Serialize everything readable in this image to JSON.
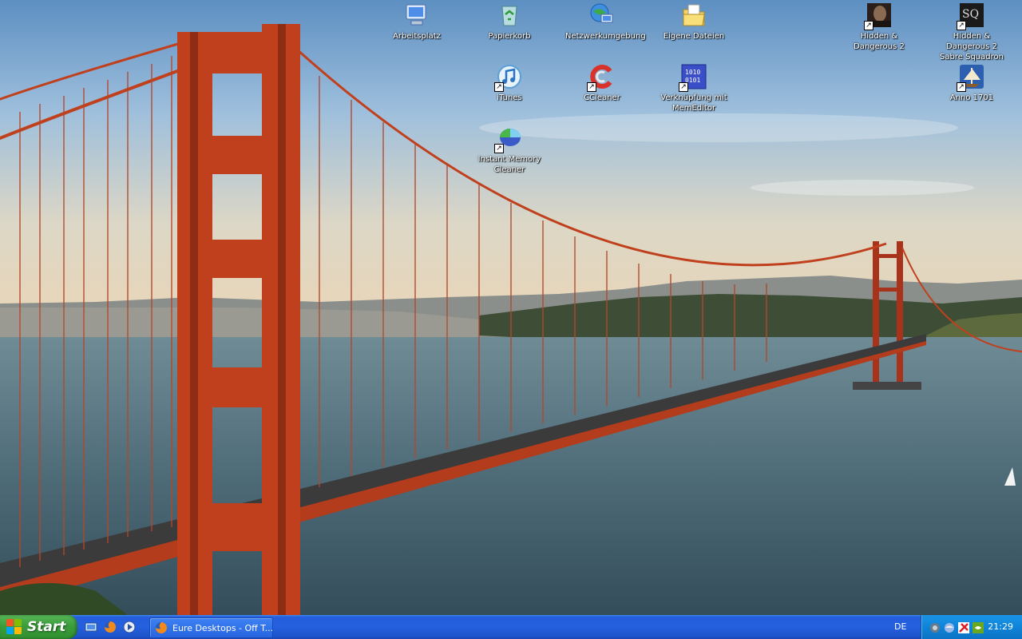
{
  "desktop": {
    "icons": [
      {
        "label": "Arbeitsplatz",
        "icon": "my-computer-icon"
      },
      {
        "label": "Papierkorb",
        "icon": "recycle-bin-icon"
      },
      {
        "label": "Netzwerkumgebung",
        "icon": "network-places-icon"
      },
      {
        "label": "Eigene Dateien",
        "icon": "my-documents-icon"
      },
      {
        "label": "Hidden & Dangerous 2",
        "icon": "hidden-dangerous-icon"
      },
      {
        "label": "Hidden & Dangerous 2 Sabre Squadron",
        "icon": "sabre-squadron-icon"
      },
      {
        "label": "iTunes",
        "icon": "itunes-icon"
      },
      {
        "label": "CCleaner",
        "icon": "ccleaner-icon"
      },
      {
        "label": "Verknüpfung mit MemEditor",
        "icon": "memeditor-icon",
        "glyph": "1010\n0101"
      },
      {
        "label": "Anno 1701",
        "icon": "anno-icon"
      },
      {
        "label": "Instant Memory Cleaner",
        "icon": "memory-cleaner-icon"
      }
    ]
  },
  "taskbar": {
    "start_label": "Start",
    "quick_launch": [
      {
        "icon": "show-desktop-icon"
      },
      {
        "icon": "firefox-icon"
      },
      {
        "icon": "media-player-icon"
      }
    ],
    "window_button": {
      "label": "Eure Desktops - Off T...",
      "icon": "firefox-icon"
    },
    "language": "DE",
    "tray_icons": [
      {
        "icon": "tray-app-icon"
      },
      {
        "icon": "tray-network-icon"
      },
      {
        "icon": "tray-antivirus-icon"
      },
      {
        "icon": "tray-nvidia-icon"
      }
    ],
    "clock": "21:29"
  },
  "colors": {
    "taskbar_blue": "#245edc",
    "start_green": "#3c9d3c",
    "tray_blue": "#0f84d8",
    "bridge_orange": "#c0401e"
  }
}
